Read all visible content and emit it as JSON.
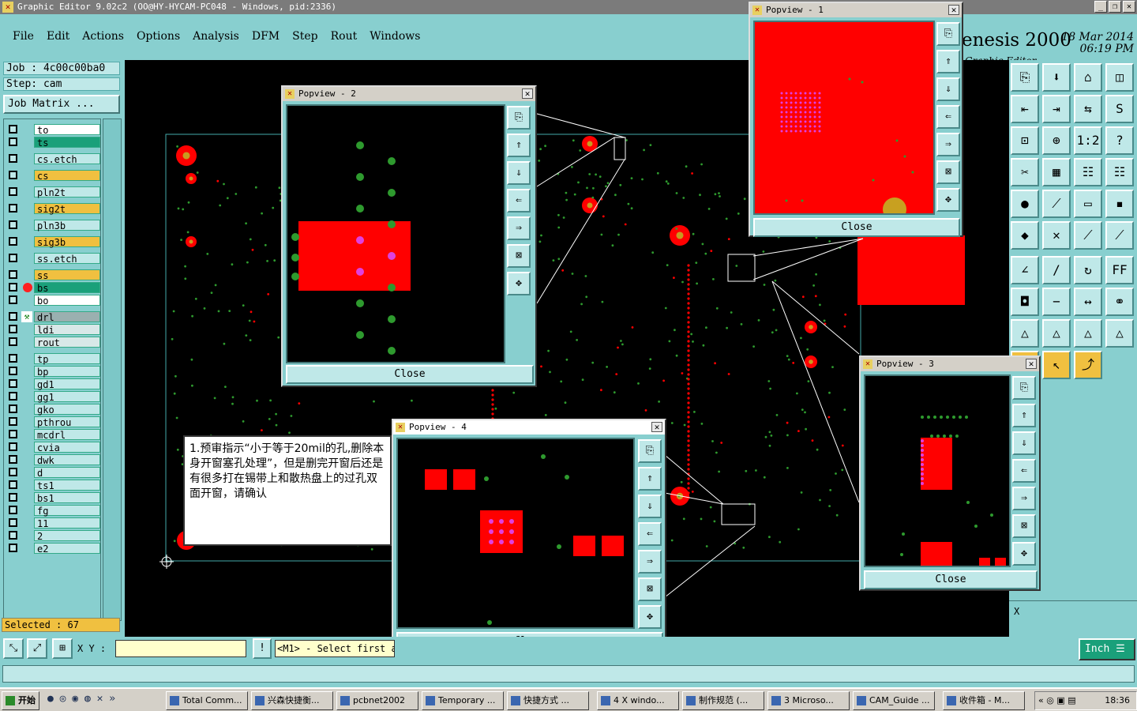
{
  "window": {
    "title": "Graphic Editor 9.02c2 (OO@HY-HYCAM-PC048 - Windows, pid:2336)"
  },
  "menu": [
    "File",
    "Edit",
    "Actions",
    "Options",
    "Analysis",
    "DFM",
    "Step",
    "Rout",
    "Windows"
  ],
  "brand": {
    "name": "enesis 2000",
    "sub": "Graphic Editor",
    "date": "18 Mar 2014",
    "time": "06:19 PM"
  },
  "job": {
    "job": "Job : 4c00c00ba0",
    "step": "Step: cam",
    "matrix": "Job Matrix ..."
  },
  "layers": [
    {
      "name": "to",
      "color": "#ffffff"
    },
    {
      "name": "ts",
      "color": "#1aa07a"
    },
    {
      "name": "cs.etch",
      "color": "#bfe8e8"
    },
    {
      "name": "cs",
      "color": "#f0c040"
    },
    {
      "name": "pln2t",
      "color": "#bfe8e8"
    },
    {
      "name": "sig2t",
      "color": "#f0c040"
    },
    {
      "name": "pln3b",
      "color": "#bfe8e8"
    },
    {
      "name": "sig3b",
      "color": "#f0c040"
    },
    {
      "name": "ss.etch",
      "color": "#bfe8e8"
    },
    {
      "name": "ss",
      "color": "#f0c040"
    },
    {
      "name": "bs",
      "color": "#1aa07a"
    },
    {
      "name": "bo",
      "color": "#ffffff"
    },
    {
      "name": "drl",
      "color": "#9ab0b0"
    },
    {
      "name": "ldi",
      "color": "#d8e8e8"
    },
    {
      "name": "rout",
      "color": "#d8e8e8"
    },
    {
      "name": "tp",
      "color": "#bfe8e8"
    },
    {
      "name": "bp",
      "color": "#bfe8e8"
    },
    {
      "name": "gd1",
      "color": "#bfe8e8"
    },
    {
      "name": "gg1",
      "color": "#bfe8e8"
    },
    {
      "name": "gko",
      "color": "#bfe8e8"
    },
    {
      "name": "pthrou",
      "color": "#bfe8e8"
    },
    {
      "name": "mcdrl",
      "color": "#bfe8e8"
    },
    {
      "name": "cvia",
      "color": "#bfe8e8"
    },
    {
      "name": "dwk",
      "color": "#bfe8e8"
    },
    {
      "name": "d",
      "color": "#bfe8e8"
    },
    {
      "name": "ts1",
      "color": "#bfe8e8"
    },
    {
      "name": "bs1",
      "color": "#bfe8e8"
    },
    {
      "name": "fg",
      "color": "#bfe8e8"
    },
    {
      "name": "11",
      "color": "#bfe8e8"
    },
    {
      "name": "2",
      "color": "#bfe8e8"
    },
    {
      "name": "e2",
      "color": "#bfe8e8"
    }
  ],
  "selected": "Selected : 67",
  "popviews": {
    "p1": {
      "title": "Popview - 1",
      "close": "Close"
    },
    "p2": {
      "title": "Popview - 2",
      "close": "Close"
    },
    "p3": {
      "title": "Popview - 3",
      "close": "Close"
    },
    "p4": {
      "title": "Popview - 4",
      "close": "Close"
    }
  },
  "note": "1.预审指示“小于等于20mil的孔,删除本身开窗塞孔处理”，但是删完开窗后还是有很多打在锡带上和散热盘上的过孔双面开窗，请确认",
  "bottom": {
    "xy_label": "X Y :",
    "xy_value": "",
    "prompt": "<M1> - Select first a",
    "unit": "Inch"
  },
  "xlabel": "X",
  "taskbar": {
    "start": "开始",
    "tasks": [
      "Total Comm...",
      "兴森快捷衡...",
      "pcbnet2002",
      "Temporary ...",
      "快捷方式 ...",
      "4 X windo...",
      "制作规范 (...",
      "3 Microso...",
      "CAM_Guide ...",
      "收件箱 - M..."
    ],
    "clock": "18:36"
  },
  "colors": {
    "pad_red": "#ff0000",
    "via_green": "#2e9a2e",
    "drill_magenta": "#e040e0",
    "bg_teal": "#88cfcf"
  }
}
